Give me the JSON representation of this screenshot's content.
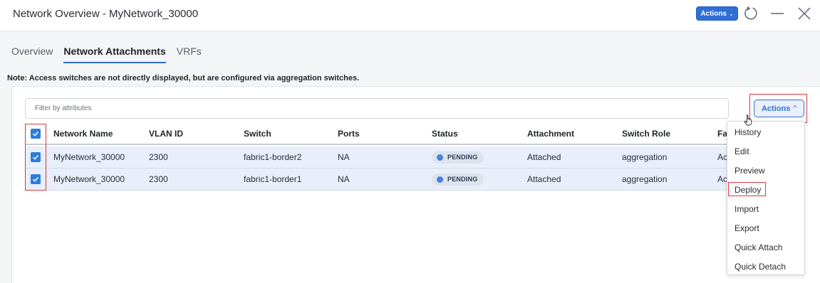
{
  "header": {
    "title": "Network Overview - MyNetwork_30000",
    "actions_label": "Actions",
    "actions_chevron": "⌄"
  },
  "tabs": [
    {
      "label": "Overview"
    },
    {
      "label": "Network Attachments"
    },
    {
      "label": "VRFs"
    }
  ],
  "note": "Note: Access switches are not directly displayed, but are configured via aggregation switches.",
  "filter": {
    "placeholder": "Filter by attributes"
  },
  "actions_button": {
    "label": "Actions",
    "chevron": "^"
  },
  "table": {
    "columns": [
      "Network Name",
      "VLAN ID",
      "Switch",
      "Ports",
      "Status",
      "Attachment",
      "Switch Role",
      "Fab"
    ],
    "rows": [
      {
        "network_name": "MyNetwork_30000",
        "vlan_id": "2300",
        "switch": "fabric1-border2",
        "ports": "NA",
        "status": "PENDING",
        "attachment": "Attached",
        "switch_role": "aggregation",
        "fabric": "Acc"
      },
      {
        "network_name": "MyNetwork_30000",
        "vlan_id": "2300",
        "switch": "fabric1-border1",
        "ports": "NA",
        "status": "PENDING",
        "attachment": "Attached",
        "switch_role": "aggregation",
        "fabric": "Acc"
      }
    ]
  },
  "menu": {
    "items": [
      "History",
      "Edit",
      "Preview",
      "Deploy",
      "Import",
      "Export",
      "Quick Attach",
      "Quick Detach"
    ]
  },
  "colors": {
    "accent": "#2e6fd6",
    "highlight": "#d9383f",
    "row_selected": "#e8effb"
  }
}
